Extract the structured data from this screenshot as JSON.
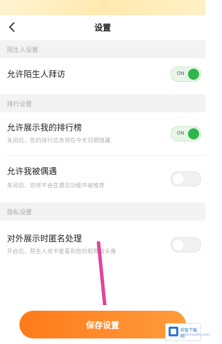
{
  "header": {
    "title": "设置",
    "back_icon": "chevron-left-icon"
  },
  "sections": [
    {
      "header": "陌生人设置"
    },
    {
      "header": "排行设置"
    },
    {
      "header": "隐私设置"
    }
  ],
  "settings": {
    "stranger_visit": {
      "label": "允许陌生人拜访",
      "toggle": "ON",
      "on": true
    },
    "show_ranking": {
      "label": "允许展示我的排行榜",
      "desc": "关闭后，您的排行信息将在今天日期隐藏",
      "toggle": "ON",
      "on": true
    },
    "be_encountered": {
      "label": "允许我被偶遇",
      "desc": "关闭后，您将不会在遇见功能中被推荐",
      "on": false
    },
    "anonymous": {
      "label": "对外展示时匿名处理",
      "desc": "开启后，陌生人将不能看到您的昵称和头像",
      "on": false
    }
  },
  "footer": {
    "save_label": "保存设置"
  },
  "watermark": {
    "name": "后智下载网",
    "url": "www.houzhi.com"
  },
  "colors": {
    "accent": "#ff8a2a",
    "toggle_on": "#2fb64a",
    "annotation_arrow": "#e0449a"
  }
}
